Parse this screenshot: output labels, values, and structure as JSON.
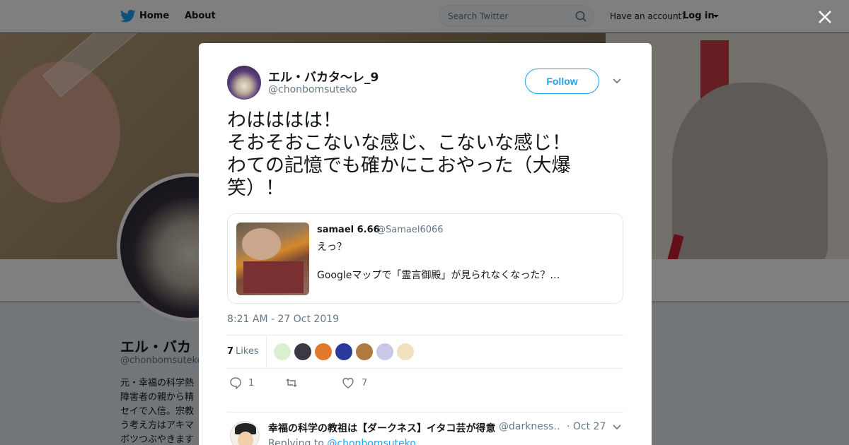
{
  "topbar": {
    "nav_home": "Home",
    "nav_about": "About",
    "search_placeholder": "Search Twitter",
    "account_prompt": "Have an account?",
    "login": "Log in"
  },
  "profile": {
    "name": "エル・バカタ～レ_9",
    "name_visible": "エル・バカ",
    "handle": "@chonbomsuteko",
    "bio_visible": "元・幸福の科学熱 障害者の親から精 セイで入信。宗教 う考え方はアキマ ボツつぶやきます"
  },
  "tweet": {
    "author_name": "エル・バカタ～レ_9",
    "author_handle": "@chonbomsuteko",
    "follow_label": "Follow",
    "text": "わはははは！\nそおそおこないな感じ、こないな感じ！\nわての記憶でも確かにこおやった（大爆\n笑）！",
    "timestamp": "8:21 AM - 27 Oct 2019",
    "likes_count": "7",
    "likes_label": "Likes",
    "reply_count": "1",
    "retweet_count": "",
    "like_count": "7"
  },
  "quote": {
    "name": "samael 6.66",
    "handle": "@Samael6066",
    "line1": "えっ？",
    "line2": "Googleマップで「霊言御殿」が見られなくなった？…"
  },
  "likers": [
    {
      "icon": "liker-avatar-1",
      "color": "#d8f0d0"
    },
    {
      "icon": "liker-avatar-2",
      "color": "#3a3a44"
    },
    {
      "icon": "liker-avatar-3",
      "color": "#e07a2a"
    },
    {
      "icon": "liker-avatar-4",
      "color": "#2a3a9a"
    },
    {
      "icon": "liker-avatar-5",
      "color": "#b07a40"
    },
    {
      "icon": "liker-avatar-6",
      "color": "#c8c8e8"
    },
    {
      "icon": "liker-avatar-7",
      "color": "#f0e0c0"
    }
  ],
  "reply": {
    "name": "幸福の科学の教祖は【ダークネス】イタコ芸が得意",
    "handle": "@darkness…",
    "date": "· Oct 27",
    "replying_to_label": "Replying to",
    "replying_to_handle": "@chonbomsuteko"
  },
  "colors": {
    "accent": "#1da1f2",
    "muted": "#657786",
    "text": "#14171a"
  }
}
